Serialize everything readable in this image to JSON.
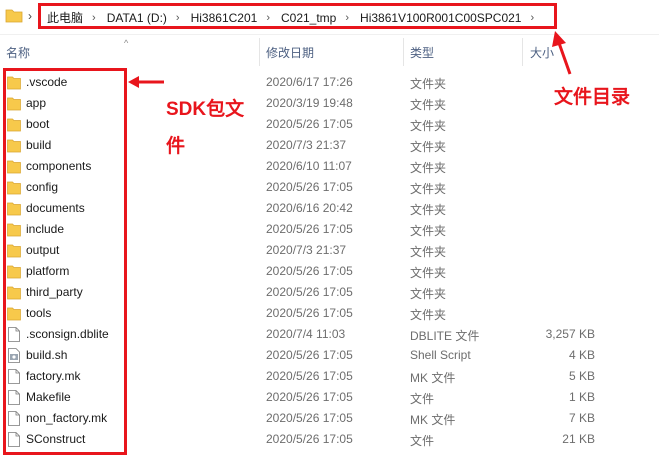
{
  "address_bar": {
    "crumbs": [
      "此电脑",
      "DATA1 (D:)",
      "Hi3861C201",
      "C021_tmp",
      "Hi3861V100R001C00SPC021"
    ]
  },
  "columns": {
    "name": "名称",
    "date": "修改日期",
    "type": "类型",
    "size": "大小"
  },
  "files": [
    {
      "name": ".vscode",
      "date": "2020/6/17 17:26",
      "type": "文件夹",
      "size": "",
      "icon": "folder-icon"
    },
    {
      "name": "app",
      "date": "2020/3/19 19:48",
      "type": "文件夹",
      "size": "",
      "icon": "folder-icon"
    },
    {
      "name": "boot",
      "date": "2020/5/26 17:05",
      "type": "文件夹",
      "size": "",
      "icon": "folder-icon"
    },
    {
      "name": "build",
      "date": "2020/7/3 21:37",
      "type": "文件夹",
      "size": "",
      "icon": "folder-icon"
    },
    {
      "name": "components",
      "date": "2020/6/10 11:07",
      "type": "文件夹",
      "size": "",
      "icon": "folder-icon"
    },
    {
      "name": "config",
      "date": "2020/5/26 17:05",
      "type": "文件夹",
      "size": "",
      "icon": "folder-icon"
    },
    {
      "name": "documents",
      "date": "2020/6/16 20:42",
      "type": "文件夹",
      "size": "",
      "icon": "folder-icon"
    },
    {
      "name": "include",
      "date": "2020/5/26 17:05",
      "type": "文件夹",
      "size": "",
      "icon": "folder-icon"
    },
    {
      "name": "output",
      "date": "2020/7/3 21:37",
      "type": "文件夹",
      "size": "",
      "icon": "folder-icon"
    },
    {
      "name": "platform",
      "date": "2020/5/26 17:05",
      "type": "文件夹",
      "size": "",
      "icon": "folder-icon"
    },
    {
      "name": "third_party",
      "date": "2020/5/26 17:05",
      "type": "文件夹",
      "size": "",
      "icon": "folder-icon"
    },
    {
      "name": "tools",
      "date": "2020/5/26 17:05",
      "type": "文件夹",
      "size": "",
      "icon": "folder-icon"
    },
    {
      "name": ".sconsign.dblite",
      "date": "2020/7/4 11:03",
      "type": "DBLITE 文件",
      "size": "3,257 KB",
      "icon": "file-icon"
    },
    {
      "name": "build.sh",
      "date": "2020/5/26 17:05",
      "type": "Shell Script",
      "size": "4 KB",
      "icon": "script-icon"
    },
    {
      "name": "factory.mk",
      "date": "2020/5/26 17:05",
      "type": "MK 文件",
      "size": "5 KB",
      "icon": "file-icon"
    },
    {
      "name": "Makefile",
      "date": "2020/5/26 17:05",
      "type": "文件",
      "size": "1 KB",
      "icon": "file-icon"
    },
    {
      "name": "non_factory.mk",
      "date": "2020/5/26 17:05",
      "type": "MK 文件",
      "size": "7 KB",
      "icon": "file-icon"
    },
    {
      "name": "SConstruct",
      "date": "2020/5/26 17:05",
      "type": "文件",
      "size": "21 KB",
      "icon": "file-icon"
    }
  ],
  "annotations": {
    "sdk_label_line1": "SDK包文",
    "sdk_label_line2": "件",
    "dir_label": "文件目录"
  },
  "colors": {
    "annotation": "#e8151c",
    "folder": "#f7c94b",
    "header_text": "#4d6082"
  }
}
